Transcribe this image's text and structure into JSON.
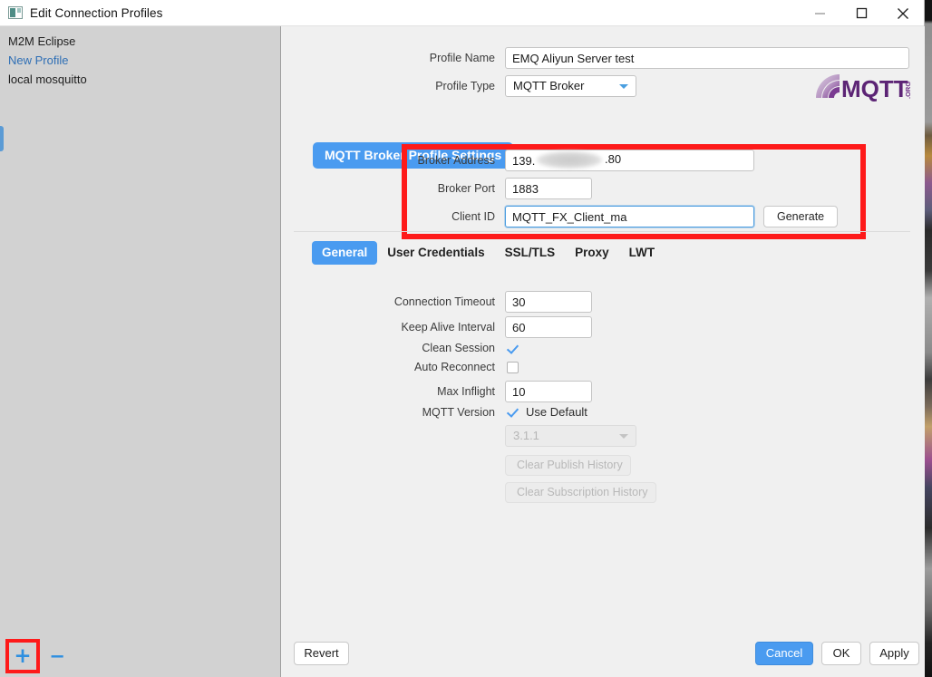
{
  "window": {
    "title": "Edit Connection Profiles",
    "icon": "window-app-icon",
    "minimize_label": "—",
    "maximize_label": "□",
    "close_label": "✕"
  },
  "sidebar": {
    "items": [
      {
        "label": "M2M Eclipse",
        "selected": false
      },
      {
        "label": "New Profile",
        "selected": true
      },
      {
        "label": "local mosquitto",
        "selected": false
      }
    ],
    "add_label": "+",
    "remove_label": "−"
  },
  "header": {
    "profile_name_label": "Profile Name",
    "profile_name_value": "EMQ Aliyun Server test",
    "profile_type_label": "Profile Type",
    "profile_type_value": "MQTT Broker",
    "logo_text": "MQTT",
    "logo_suffix": ".ORG"
  },
  "section": {
    "pill_label": "MQTT Broker Profile Settings",
    "broker_address_label": "Broker Address",
    "broker_address_value": "139.",
    "broker_address_value_tail": ".80",
    "broker_port_label": "Broker Port",
    "broker_port_value": "1883",
    "client_id_label": "Client ID",
    "client_id_value": "MQTT_FX_Client_ma",
    "generate_label": "Generate"
  },
  "tabs": [
    {
      "label": "General",
      "active": true
    },
    {
      "label": "User Credentials",
      "active": false
    },
    {
      "label": "SSL/TLS",
      "active": false
    },
    {
      "label": "Proxy",
      "active": false
    },
    {
      "label": "LWT",
      "active": false
    }
  ],
  "general": {
    "connection_timeout_label": "Connection Timeout",
    "connection_timeout_value": "30",
    "keep_alive_label": "Keep Alive Interval",
    "keep_alive_value": "60",
    "clean_session_label": "Clean Session",
    "clean_session_checked": true,
    "auto_reconnect_label": "Auto Reconnect",
    "auto_reconnect_checked": false,
    "max_inflight_label": "Max Inflight",
    "max_inflight_value": "10",
    "mqtt_version_label": "MQTT Version",
    "use_default_label": "Use Default",
    "use_default_checked": true,
    "version_value": "3.1.1",
    "clear_publish_label": "Clear Publish History",
    "clear_subscription_label": "Clear Subscription History"
  },
  "footer": {
    "revert_label": "Revert",
    "cancel_label": "Cancel",
    "ok_label": "OK",
    "apply_label": "Apply"
  },
  "colors": {
    "accent_blue": "#4a9bf0",
    "highlight_red": "#fe1a1a",
    "link_blue": "#2f6fb5",
    "logo_purple": "#6b2d7a"
  }
}
